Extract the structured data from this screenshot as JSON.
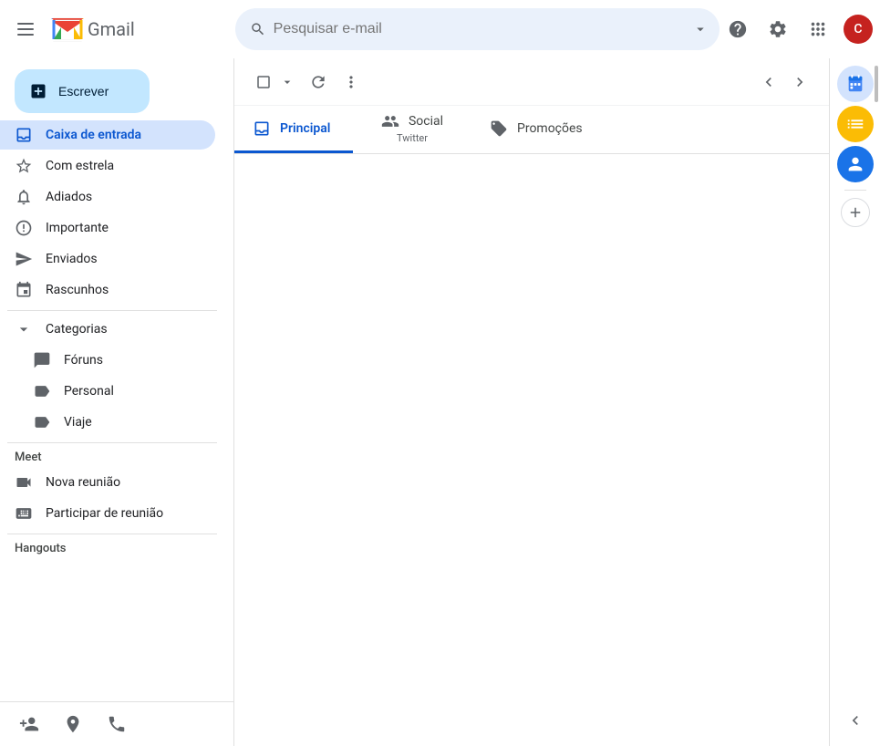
{
  "topbar": {
    "hamburger_label": "☰",
    "gmail_text": "Gmail",
    "search_placeholder": "Pesquisar e-mail",
    "help_title": "Ajuda",
    "settings_title": "Configurações",
    "apps_title": "Aplicativos Google",
    "avatar_letter": "C"
  },
  "compose": {
    "label": "Escrever",
    "plus_icon": "✚"
  },
  "sidebar": {
    "items": [
      {
        "id": "inbox",
        "label": "Caixa de entrada",
        "icon": "inbox",
        "active": true
      },
      {
        "id": "starred",
        "label": "Com estrela",
        "icon": "star"
      },
      {
        "id": "snoozed",
        "label": "Adiados",
        "icon": "snooze"
      },
      {
        "id": "important",
        "label": "Importante",
        "icon": "label_important"
      },
      {
        "id": "sent",
        "label": "Enviados",
        "icon": "send"
      },
      {
        "id": "drafts",
        "label": "Rascunhos",
        "icon": "drafts"
      }
    ],
    "categories_label": "Categorias",
    "categories_items": [
      {
        "id": "forums",
        "label": "Fóruns",
        "icon": "forums"
      },
      {
        "id": "personal",
        "label": "Personal",
        "icon": "label"
      },
      {
        "id": "travel",
        "label": "Viaje",
        "icon": "label"
      }
    ],
    "meet_label": "Meet",
    "meet_items": [
      {
        "id": "new_meeting",
        "label": "Nova reunião",
        "icon": "videocam"
      },
      {
        "id": "join_meeting",
        "label": "Participar de reunião",
        "icon": "keyboard"
      }
    ],
    "hangouts_label": "Hangouts"
  },
  "toolbar": {
    "select_all_title": "Selecionar tudo",
    "refresh_title": "Atualizar",
    "more_title": "Mais",
    "prev_title": "Anterior",
    "next_title": "Próxima"
  },
  "tabs": [
    {
      "id": "principal",
      "label": "Principal",
      "icon": "inbox",
      "sub": "",
      "active": true
    },
    {
      "id": "social",
      "label": "Social",
      "icon": "people",
      "sub": "Twitter",
      "active": false
    },
    {
      "id": "promocoes",
      "label": "Promoções",
      "icon": "tag",
      "sub": "",
      "active": false
    }
  ],
  "right_panel": {
    "icons": [
      {
        "id": "calendar",
        "icon": "📅",
        "label": "Agenda"
      },
      {
        "id": "tasks",
        "icon": "✔",
        "label": "Tasks",
        "active": true
      },
      {
        "id": "contacts",
        "icon": "👤",
        "label": "Contatos"
      }
    ],
    "add_label": "+"
  },
  "bottom_bar": {
    "add_contact": "👤",
    "location": "📍",
    "phone": "📞"
  }
}
